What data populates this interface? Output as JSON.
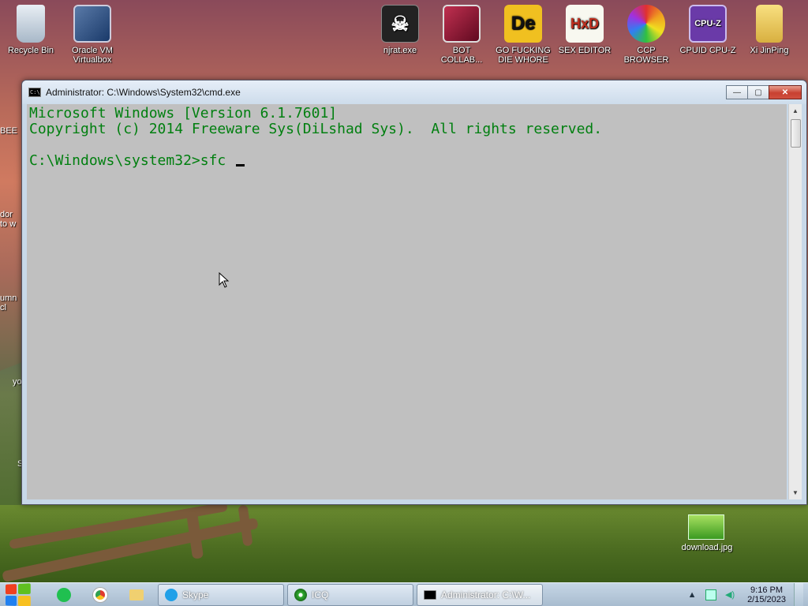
{
  "desktop": {
    "icons": [
      {
        "label": "Recycle Bin"
      },
      {
        "label": "Oracle VM Virtualbox"
      },
      {
        "label": "njrat.exe"
      },
      {
        "label": "BOT COLLAB..."
      },
      {
        "label": "GO FUCKING DIE WHORE"
      },
      {
        "label": "SEX EDITOR"
      },
      {
        "label": "CCP BROWSER"
      },
      {
        "label": "CPUID CPU-Z"
      },
      {
        "label": "Xi JinPing"
      },
      {
        "label": "download.jpg"
      }
    ],
    "partial_labels": [
      "BEE",
      "dor",
      "to w",
      "umn",
      "cl",
      "yo",
      "S"
    ],
    "icon_glyphs": {
      "de": "De",
      "hxd": "HxD",
      "cpuz": "CPU-Z"
    }
  },
  "window": {
    "title": "Administrator: C:\\Windows\\System32\\cmd.exe",
    "icon_text": "C:\\",
    "minimize_label": "—",
    "maximize_label": "▢",
    "close_label": "✕",
    "console_lines": [
      "Microsoft Windows [Version 6.1.7601]",
      "Copyright (c) 2014 Freeware Sys(DiLshad Sys).  All rights reserved.",
      "",
      "C:\\Windows\\system32>sfc "
    ]
  },
  "taskbar": {
    "buttons": [
      {
        "label": "Skype"
      },
      {
        "label": "ICQ"
      },
      {
        "label": "Administrator: C:\\W..."
      }
    ],
    "clock_time": "9:16 PM",
    "clock_date": "2/15/2023"
  },
  "colors": {
    "console_text": "#007f0f",
    "console_bg": "#c0c0c0"
  }
}
